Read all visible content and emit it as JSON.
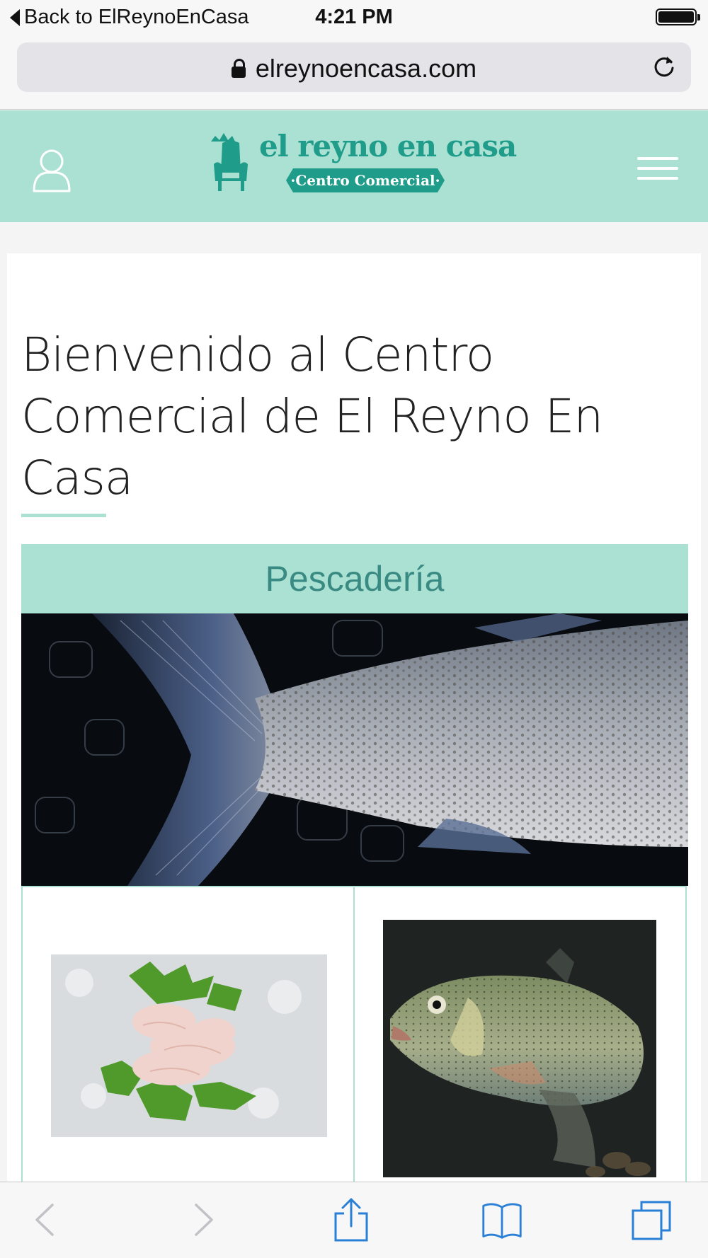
{
  "status_bar": {
    "back_label": "Back to ElReynoEnCasa",
    "time": "4:21 PM"
  },
  "url_bar": {
    "url": "elreynoencasa.com"
  },
  "header": {
    "logo_text": "el reyno en casa",
    "logo_tagline": "·Centro Comercial·"
  },
  "main": {
    "welcome_title": "Bienvenido al Centro Comercial de El Reyno En Casa",
    "section_title": "Pescadería"
  },
  "colors": {
    "header_bg": "#aae1d2",
    "brand_teal": "#1f9c8a",
    "section_text": "#3a8a84"
  },
  "icons": {
    "status_back": "back-triangle-icon",
    "lock": "lock-icon",
    "reload": "reload-icon",
    "user": "user-icon",
    "menu": "hamburger-menu-icon",
    "toolbar": [
      "back-arrow-icon",
      "forward-arrow-icon",
      "share-icon",
      "bookmarks-icon",
      "tabs-icon"
    ]
  }
}
